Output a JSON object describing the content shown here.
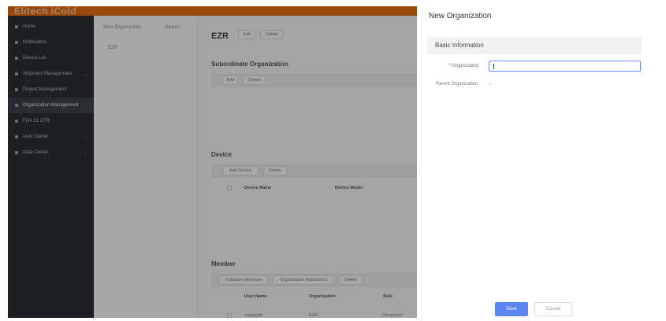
{
  "app": {
    "logo": "Elitech iCold",
    "brand_color": "#e06b10"
  },
  "sidebar": {
    "items": [
      {
        "label": "Home",
        "icon": "home-icon"
      },
      {
        "label": "Notification",
        "icon": "bell-icon"
      },
      {
        "label": "Device List",
        "icon": "list-icon"
      },
      {
        "label": "Shipment Management",
        "icon": "truck-icon",
        "expandable": true
      },
      {
        "label": "Project Management",
        "icon": "project-icon"
      },
      {
        "label": "Organization Management",
        "icon": "org-icon",
        "active": true
      },
      {
        "label": "FDA 21 CFR",
        "icon": "shield-icon"
      },
      {
        "label": "User Center",
        "icon": "user-icon",
        "expandable": true
      },
      {
        "label": "Data Center",
        "icon": "data-icon",
        "expandable": true
      }
    ]
  },
  "org_panel": {
    "tabs": [
      "View Organization",
      "Search"
    ],
    "items": [
      "EZR"
    ]
  },
  "main": {
    "title": "EZR",
    "edit_label": "Edit",
    "delete_label": "Delete",
    "subordinate": {
      "title": "Subordinate Organization",
      "add_label": "Add",
      "delete_label": "Delete"
    },
    "device": {
      "title": "Device",
      "add_label": "Add Device",
      "delete_label": "Delete",
      "columns": [
        "Device Name",
        "Device Model"
      ]
    },
    "member": {
      "title": "Member",
      "invite_label": "Invitation Members",
      "adjust_label": "Organization Adjustment",
      "delete_label": "Delete",
      "columns": [
        "User Name",
        "Organization",
        "Role"
      ],
      "rows": [
        {
          "user": "supplyjob",
          "org": "EZR",
          "role": "Personnel"
        }
      ]
    }
  },
  "drawer": {
    "title": "New Organization",
    "section": "Basic Information",
    "org_label": "Organization:",
    "org_required": "*",
    "org_value": "",
    "parent_label": "Parent Organization:",
    "parent_value": "--",
    "save_label": "Save",
    "cancel_label": "Cancel",
    "accent_color": "#5b86f0"
  }
}
